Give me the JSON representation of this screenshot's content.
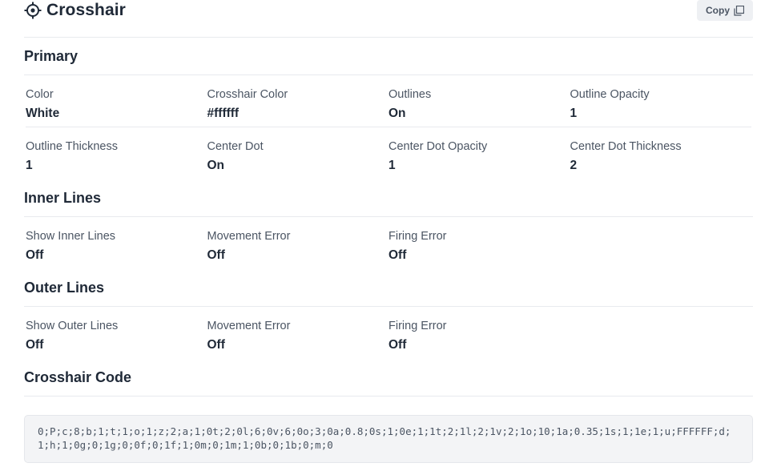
{
  "header": {
    "title": "Crosshair",
    "copy_label": "Copy"
  },
  "primary": {
    "title": "Primary",
    "items": [
      {
        "label": "Color",
        "value": "White"
      },
      {
        "label": "Crosshair Color",
        "value": "#ffffff"
      },
      {
        "label": "Outlines",
        "value": "On"
      },
      {
        "label": "Outline Opacity",
        "value": "1"
      },
      {
        "label": "Outline Thickness",
        "value": "1"
      },
      {
        "label": "Center Dot",
        "value": "On"
      },
      {
        "label": "Center Dot Opacity",
        "value": "1"
      },
      {
        "label": "Center Dot Thickness",
        "value": "2"
      }
    ]
  },
  "inner": {
    "title": "Inner Lines",
    "items": [
      {
        "label": "Show Inner Lines",
        "value": "Off"
      },
      {
        "label": "Movement Error",
        "value": "Off"
      },
      {
        "label": "Firing Error",
        "value": "Off"
      }
    ]
  },
  "outer": {
    "title": "Outer Lines",
    "items": [
      {
        "label": "Show Outer Lines",
        "value": "Off"
      },
      {
        "label": "Movement Error",
        "value": "Off"
      },
      {
        "label": "Firing Error",
        "value": "Off"
      }
    ]
  },
  "code": {
    "title": "Crosshair Code",
    "value": "0;P;c;8;b;1;t;1;o;1;z;2;a;1;0t;2;0l;6;0v;6;0o;3;0a;0.8;0s;1;0e;1;1t;2;1l;2;1v;2;1o;10;1a;0.35;1s;1;1e;1;u;FFFFFF;d;1;h;1;0g;0;1g;0;0f;0;1f;1;0m;0;1m;1;0b;0;1b;0;m;0"
  }
}
